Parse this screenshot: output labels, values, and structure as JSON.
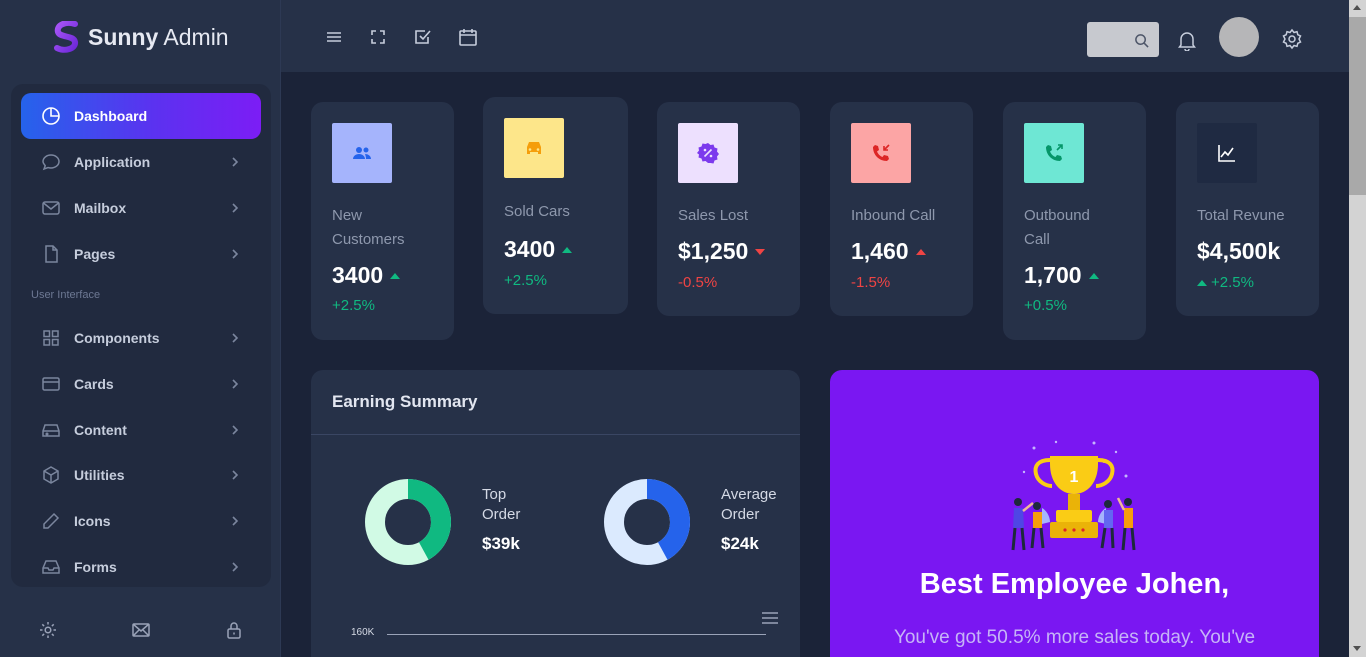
{
  "brand": {
    "name_bold": "Sunny",
    "name_light": "Admin"
  },
  "sidebar": {
    "items": [
      {
        "label": "Dashboard",
        "icon": "dashboard-icon",
        "active": true
      },
      {
        "label": "Application",
        "icon": "chat-icon"
      },
      {
        "label": "Mailbox",
        "icon": "mail-icon"
      },
      {
        "label": "Pages",
        "icon": "page-icon"
      },
      {
        "label": "Components",
        "icon": "grid-icon"
      },
      {
        "label": "Cards",
        "icon": "card-icon"
      },
      {
        "label": "Content",
        "icon": "drive-icon"
      },
      {
        "label": "Utilities",
        "icon": "box-icon"
      },
      {
        "label": "Icons",
        "icon": "pencil-icon"
      },
      {
        "label": "Forms",
        "icon": "inbox-icon"
      }
    ],
    "section_label": "User Interface",
    "bottom_icons": [
      "settings-icon",
      "mail-icon",
      "lock-icon"
    ]
  },
  "topbar": {
    "icons": [
      "menu-icon",
      "fullscreen-icon",
      "checklist-icon",
      "calendar-icon"
    ],
    "right_icons": [
      "search-icon",
      "bell-icon",
      "avatar",
      "settings-icon"
    ]
  },
  "stats": [
    {
      "label_1": "New",
      "label_2": "Customers",
      "value": "3400",
      "trend": "up",
      "delta": "+2.5%",
      "delta_color": "green",
      "tile_color": "#a5b4fc",
      "icon": "users-icon"
    },
    {
      "label_1": "Sold Cars",
      "value": "3400",
      "trend": "up",
      "delta": "+2.5%",
      "delta_color": "green",
      "tile_color": "#fde68a",
      "icon": "car-icon"
    },
    {
      "label_1": "Sales Lost",
      "value": "$1,250",
      "trend": "down",
      "delta": "-0.5%",
      "delta_color": "red",
      "tile_color": "#ede0fe",
      "icon": "discount-icon"
    },
    {
      "label_1": "Inbound Call",
      "value": "1,460",
      "trend": "down",
      "delta": "-1.5%",
      "delta_color": "red",
      "tile_color": "#fca5a5",
      "icon": "incoming-call-icon"
    },
    {
      "label_1": "Outbound",
      "label_2": "Call",
      "value": "1,700",
      "trend": "up",
      "delta": "+0.5%",
      "delta_color": "green",
      "tile_color": "#6ee7d4",
      "icon": "outgoing-call-icon"
    },
    {
      "label_1": "Total Revune",
      "value": "$4,500k",
      "trend": "up",
      "delta": "+2.5%",
      "delta_color": "green",
      "tile_color": "#1f2a42",
      "icon": "chart-line-icon"
    }
  ],
  "earning": {
    "title": "Earning Summary",
    "items": [
      {
        "label_1": "Top",
        "label_2": "Order",
        "value": "$39k",
        "fraction": 0.42,
        "fill": "#10b981",
        "track": "#d1fae5"
      },
      {
        "label_1": "Average",
        "label_2": "Order",
        "value": "$24k",
        "fraction": 0.42,
        "fill": "#2563eb",
        "track": "#dbeafe"
      }
    ],
    "chart_axis_label": "160K"
  },
  "promo": {
    "title": "Best Employee Johen,",
    "text": "You've got 50.5% more sales today. You've"
  }
}
